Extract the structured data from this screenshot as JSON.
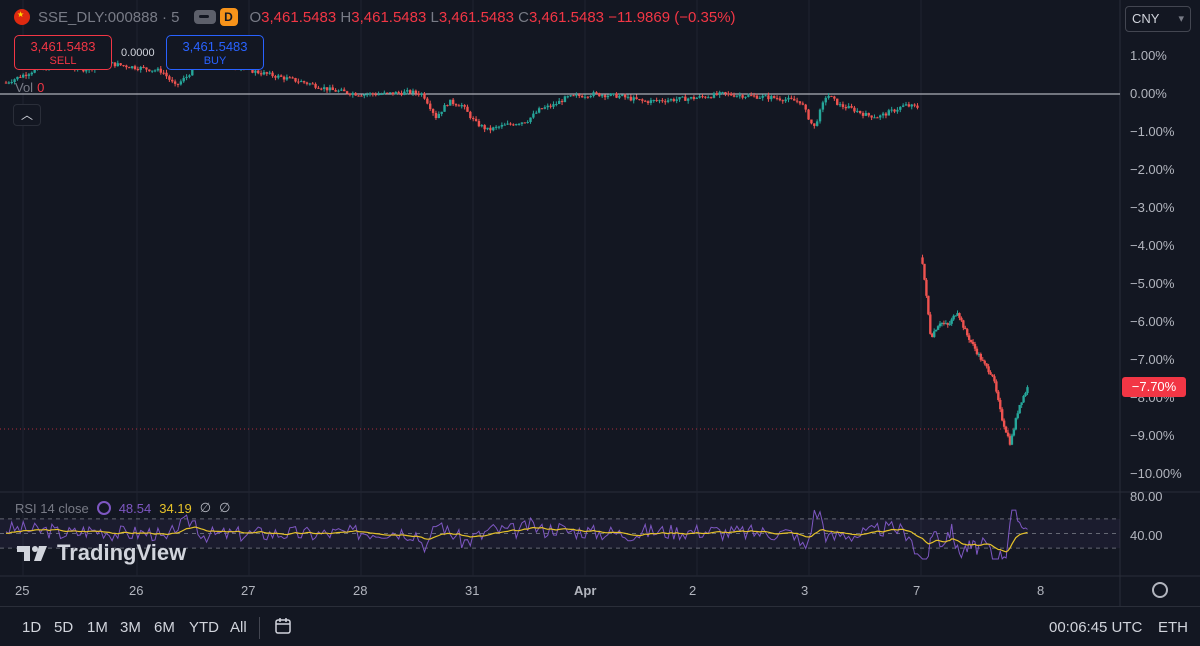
{
  "header": {
    "symbol": "SSE_DLY:000888 · 5",
    "ohlc": [
      {
        "key": "O",
        "value": "3,461.5483"
      },
      {
        "key": "H",
        "value": "3,461.5483"
      },
      {
        "key": "L",
        "value": "3,461.5483"
      },
      {
        "key": "C",
        "value": "3,461.5483"
      }
    ],
    "change": "−11.9869 (−0.35%)",
    "toggle_icon": "eye-toggle-icon",
    "badge": "D"
  },
  "trade": {
    "sell_price": "3,461.5483",
    "sell_label": "SELL",
    "buy_price": "3,461.5483",
    "buy_label": "BUY",
    "spread": "0.0000"
  },
  "volume": {
    "label": "Vol",
    "value": "0"
  },
  "currency": "CNY",
  "price_axis": [
    "1.00%",
    "0.00%",
    "−1.00%",
    "−2.00%",
    "−3.00%",
    "−4.00%",
    "−5.00%",
    "−6.00%",
    "−7.00%",
    "−8.00%",
    "−9.00%",
    "−10.00%"
  ],
  "last_price_badge": "−7.70%",
  "rsi": {
    "label": "RSI 14 close",
    "value": "48.54",
    "ma_value": "34.19",
    "empty1": "∅",
    "empty2": "∅",
    "axis": [
      "80.00",
      "40.00"
    ]
  },
  "logo": "TradingView",
  "time_axis": [
    "25",
    "26",
    "27",
    "28",
    "31",
    "Apr",
    "2",
    "3",
    "7",
    "8"
  ],
  "toolbar": {
    "ranges": [
      "1D",
      "5D",
      "1M",
      "3M",
      "6M",
      "YTD",
      "All"
    ],
    "time": "00:06:45 UTC",
    "session": "ETH"
  },
  "colors": {
    "up": "#26a69a",
    "down": "#ef5350",
    "rsi": "#7e57c2",
    "rsi_ma": "#e6c229",
    "bg": "#131722"
  },
  "chart_data": {
    "type": "candlestick",
    "unit": "% change",
    "x_ticks": [
      "25",
      "26",
      "27",
      "28",
      "31",
      "Apr",
      "2",
      "3",
      "7",
      "8"
    ],
    "ylim": [
      -10.5,
      1.5
    ],
    "baseline": 0.0,
    "close_path": [
      [
        0,
        0.3
      ],
      [
        2,
        0.6
      ],
      [
        4,
        0.75
      ],
      [
        6,
        0.65
      ],
      [
        8,
        0.8
      ],
      [
        10,
        0.7
      ],
      [
        12,
        0.6
      ],
      [
        13,
        0.2
      ],
      [
        14,
        0.5
      ],
      [
        15,
        1.05
      ],
      [
        17,
        0.8
      ],
      [
        19,
        0.6
      ],
      [
        21,
        0.45
      ],
      [
        23,
        0.3
      ],
      [
        25,
        0.1
      ],
      [
        27,
        0.0
      ],
      [
        29,
        0.0
      ],
      [
        31,
        0.05
      ],
      [
        32,
        0.0
      ],
      [
        33,
        -0.6
      ],
      [
        34,
        -0.2
      ],
      [
        35,
        -0.3
      ],
      [
        36,
        -0.75
      ],
      [
        37,
        -0.95
      ],
      [
        38,
        -0.85
      ],
      [
        40,
        -0.7
      ],
      [
        41,
        -0.4
      ],
      [
        42,
        -0.3
      ],
      [
        43,
        -0.1
      ],
      [
        45,
        0.0
      ],
      [
        47,
        -0.05
      ],
      [
        49,
        -0.2
      ],
      [
        51,
        -0.15
      ],
      [
        53,
        -0.1
      ],
      [
        55,
        0.0
      ],
      [
        57,
        -0.05
      ],
      [
        59,
        -0.1
      ],
      [
        61,
        -0.2
      ],
      [
        62,
        -0.9
      ],
      [
        63,
        0.0
      ],
      [
        64,
        -0.3
      ],
      [
        65,
        -0.4
      ],
      [
        66,
        -0.55
      ],
      [
        67,
        -0.6
      ],
      [
        68,
        -0.45
      ],
      [
        69,
        -0.3
      ],
      [
        70,
        -0.35
      ],
      [
        71,
        -4.3
      ],
      [
        72,
        -6.4
      ],
      [
        73,
        -6.0
      ],
      [
        74,
        -6.1
      ],
      [
        75,
        -5.7
      ],
      [
        76,
        -6.3
      ],
      [
        77,
        -6.7
      ],
      [
        78,
        -7.1
      ],
      [
        79,
        -7.4
      ],
      [
        80,
        -8.5
      ],
      [
        81,
        -9.2
      ],
      [
        82,
        -8.2
      ],
      [
        83,
        -7.7
      ]
    ],
    "rsi_ylim": [
      10,
      100
    ],
    "rsi_levels": [
      70,
      50,
      30
    ]
  }
}
